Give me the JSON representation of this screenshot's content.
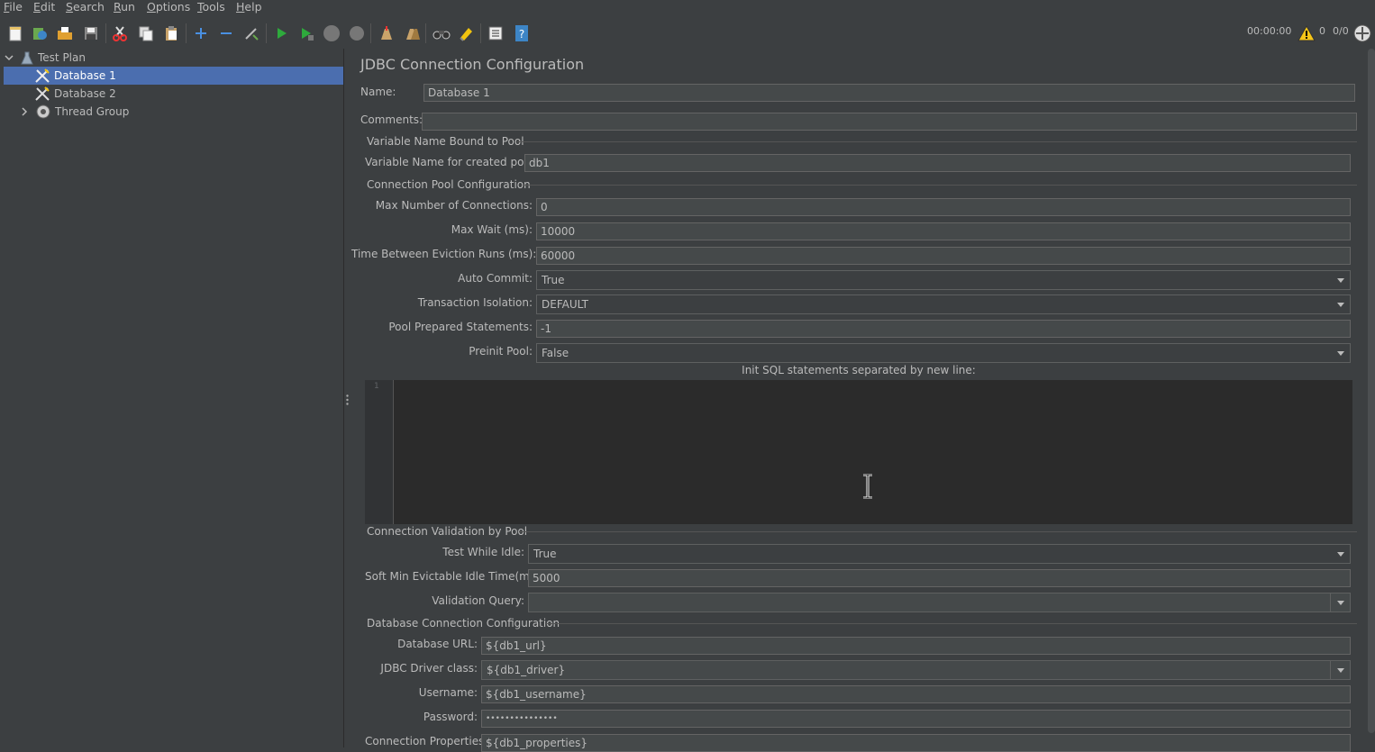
{
  "menu": {
    "items": [
      {
        "label": "File"
      },
      {
        "label": "Edit"
      },
      {
        "label": "Search"
      },
      {
        "label": "Run"
      },
      {
        "label": "Options"
      },
      {
        "label": "Tools"
      },
      {
        "label": "Help"
      }
    ]
  },
  "toolbar": {
    "buttons": [
      "new-icon",
      "templates-icon",
      "open-icon",
      "save-icon",
      "cut-icon",
      "copy-icon",
      "paste-icon",
      "expand-icon",
      "collapse-icon",
      "toggle-icon",
      "start-icon",
      "start-no-pause-icon",
      "stop-icon",
      "shutdown-icon",
      "clear-icon",
      "clear-all-icon",
      "search-icon",
      "reset-search-icon",
      "function-helper-icon",
      "help-icon"
    ],
    "timer": "00:00:00",
    "warnings": "0",
    "threads": "0/0"
  },
  "tree": {
    "items": [
      {
        "label": "Test Plan",
        "icon": "test-plan-icon"
      },
      {
        "label": "Database 1",
        "icon": "config-element-icon",
        "selected": true
      },
      {
        "label": "Database 2",
        "icon": "config-element-icon"
      },
      {
        "label": "Thread Group",
        "icon": "thread-group-icon"
      }
    ]
  },
  "form": {
    "title": "JDBC Connection Configuration",
    "name_label": "Name:",
    "name_value": "Database 1",
    "comments_label": "Comments:",
    "comments_value": "",
    "sec_variable": "Variable Name Bound to Pool",
    "pool_var_label": "Variable Name for created pool:",
    "pool_var_value": "db1",
    "sec_pool": "Connection Pool Configuration",
    "max_conn_label": "Max Number of Connections:",
    "max_conn_value": "0",
    "max_wait_label": "Max Wait (ms):",
    "max_wait_value": "10000",
    "eviction_label": "Time Between Eviction Runs (ms):",
    "eviction_value": "60000",
    "auto_commit_label": "Auto Commit:",
    "auto_commit_value": "True",
    "isolation_label": "Transaction Isolation:",
    "isolation_value": "DEFAULT",
    "prepared_label": "Pool Prepared Statements:",
    "prepared_value": "-1",
    "preinit_label": "Preinit Pool:",
    "preinit_value": "False",
    "init_sql_label": "Init SQL statements separated by new line:",
    "init_sql_line": "1",
    "sec_validation": "Connection Validation by Pool",
    "test_idle_label": "Test While Idle:",
    "test_idle_value": "True",
    "soft_min_label": "Soft Min Evictable Idle Time(ms):",
    "soft_min_value": "5000",
    "validation_query_label": "Validation Query:",
    "validation_query_value": "",
    "sec_db": "Database Connection Configuration",
    "db_url_label": "Database URL:",
    "db_url_value": "${db1_url}",
    "driver_label": "JDBC Driver class:",
    "driver_value": "${db1_driver}",
    "username_label": "Username:",
    "username_value": "${db1_username}",
    "password_label": "Password:",
    "password_value": "•••••••••••••••",
    "props_label": "Connection Properties:",
    "props_value": "${db1_properties}"
  },
  "colors": {
    "background": "#3c3f41",
    "selection": "#4b6eaf",
    "editor": "#2b2b2b",
    "field": "#45494a",
    "text": "#bbbbbb"
  }
}
